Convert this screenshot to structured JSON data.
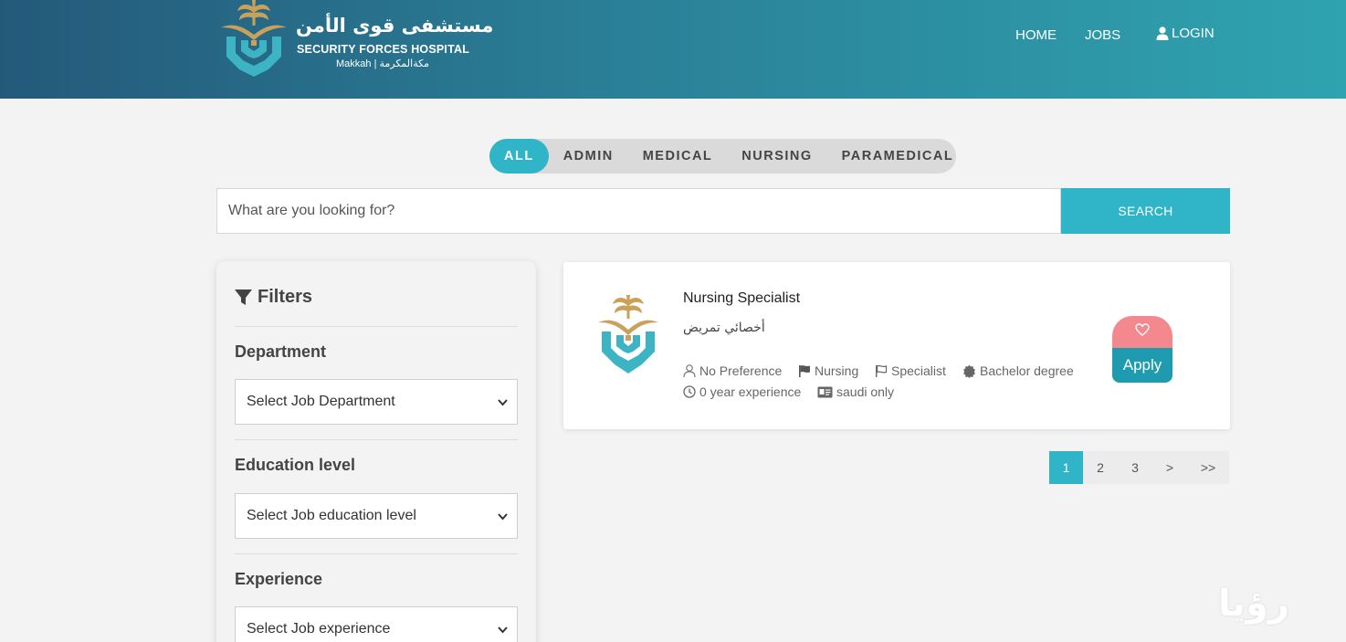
{
  "header": {
    "logo_ar": "مستشفى قوى الأمن",
    "logo_en": "SECURITY FORCES HOSPITAL",
    "logo_city": "Makkah | مكةالمكرمة",
    "nav": {
      "home": "HOME",
      "jobs": "JOBS",
      "login": "LOGIN"
    }
  },
  "tabs": [
    "ALL",
    "ADMIN",
    "MEDICAL",
    "NURSING",
    "PARAMEDICAL"
  ],
  "search": {
    "placeholder": "What are you looking for?",
    "button": "SEARCH"
  },
  "filters": {
    "title": "Filters",
    "department": {
      "label": "Department",
      "value": "Select Job Department"
    },
    "education": {
      "label": "Education level",
      "value": "Select Job education level"
    },
    "experience": {
      "label": "Experience",
      "value": "Select Job experience"
    }
  },
  "job": {
    "title": "Nursing Specialist",
    "title_ar": "أخصائي تمريض",
    "gender": "No Preference",
    "category": "Nursing",
    "rank": "Specialist",
    "degree": "Bachelor degree",
    "experience": "0 year experience",
    "nationality": "saudi only",
    "apply": "Apply"
  },
  "pagination": [
    "1",
    "2",
    "3",
    ">",
    ">>"
  ],
  "watermark": "رؤيا",
  "colors": {
    "accent": "#2fb4c8",
    "header_start": "#24597a",
    "header_end": "#2fa3b0",
    "favorite": "#f4888f"
  }
}
